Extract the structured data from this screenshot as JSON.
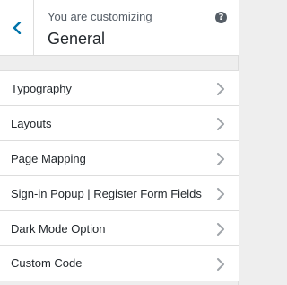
{
  "header": {
    "subtitle": "You are customizing",
    "title": "General",
    "help_symbol": "?",
    "back_icon": "chevron-left-icon",
    "help_icon": "help-icon"
  },
  "sections": [
    {
      "label": "Typography"
    },
    {
      "label": "Layouts"
    },
    {
      "label": "Page Mapping"
    },
    {
      "label": "Sign-in Popup | Register Form Fields"
    },
    {
      "label": "Dark Mode Option"
    },
    {
      "label": "Custom Code"
    }
  ],
  "colors": {
    "accent": "#0073aa",
    "background": "#eeeeee",
    "panel": "#ffffff",
    "border": "#dddddd",
    "text": "#23282d",
    "muted": "#555d66",
    "chevron": "#a0a5aa"
  }
}
